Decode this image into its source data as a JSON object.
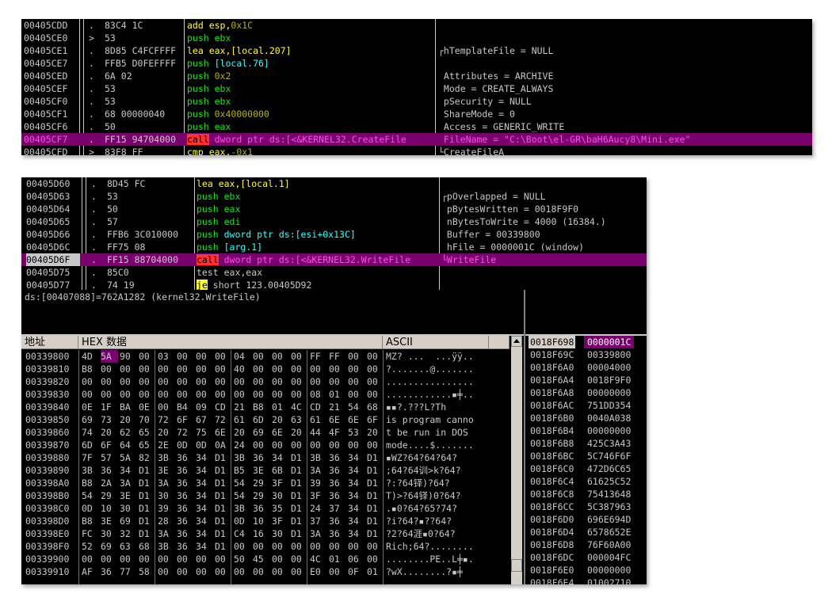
{
  "panel1": {
    "rows": [
      {
        "addr": "00405CDD",
        "mark": ".",
        "hex": "83C4 1C",
        "asm": [
          [
            "add esp,",
            "t-yel"
          ],
          [
            "0x1C",
            "t-olv"
          ]
        ],
        "comment": ""
      },
      {
        "addr": "00405CE0",
        "mark": ">",
        "hex": "53",
        "asm": [
          [
            "push ebx",
            "t-grn"
          ]
        ],
        "comment": ""
      },
      {
        "addr": "00405CE1",
        "mark": ".",
        "hex": "8D85 C4FCFFFF",
        "asm": [
          [
            "lea eax,[local.207]",
            "t-yel"
          ]
        ],
        "comment": "┌hTemplateFile = NULL"
      },
      {
        "addr": "00405CE7",
        "mark": ".",
        "hex": "FFB5 D0FEFFFF",
        "asm": [
          [
            "push ",
            "t-grn"
          ],
          [
            "[local.76]",
            "t-cyn"
          ]
        ],
        "comment": ""
      },
      {
        "addr": "00405CED",
        "mark": ".",
        "hex": "6A 02",
        "asm": [
          [
            "push ",
            "t-grn"
          ],
          [
            "0x2",
            "t-olv"
          ]
        ],
        "comment": " Attributes = ARCHIVE"
      },
      {
        "addr": "00405CEF",
        "mark": ".",
        "hex": "53",
        "asm": [
          [
            "push ebx",
            "t-grn"
          ]
        ],
        "comment": " Mode = CREATE_ALWAYS"
      },
      {
        "addr": "00405CF0",
        "mark": ".",
        "hex": "53",
        "asm": [
          [
            "push ebx",
            "t-grn"
          ]
        ],
        "comment": " pSecurity = NULL"
      },
      {
        "addr": "00405CF1",
        "mark": ".",
        "hex": "68 00000040",
        "asm": [
          [
            "push ",
            "t-grn"
          ],
          [
            "0x40000000",
            "t-olv"
          ]
        ],
        "comment": " ShareMode = 0"
      },
      {
        "addr": "00405CF6",
        "mark": ".",
        "hex": "50",
        "asm": [
          [
            "push eax",
            "t-grn"
          ]
        ],
        "comment": " Access = GENERIC_WRITE"
      },
      {
        "addr": "00405CF7",
        "mark": ".",
        "hex": "FF15 94704000",
        "asm": [
          [
            "call",
            "t-call"
          ],
          [
            " dword ptr ds:[<&KERNEL32.CreateFile",
            "t-mag"
          ]
        ],
        "comment": " FileName = \"C:\\Boot\\el-GR\\baH6Aucy8\\Mini.exe\""
      },
      {
        "addr": "00405CFD",
        "mark": ">",
        "hex": "83F8 FF",
        "asm": [
          [
            "cmp eax,",
            "t-yel"
          ],
          [
            "-0x1",
            "t-olv"
          ]
        ],
        "comment": "└CreateFileA"
      }
    ]
  },
  "panel2": {
    "rows": [
      {
        "addr": "00405D60",
        "mark": ".",
        "hex": "8D45 FC",
        "asm": [
          [
            "lea eax,[local.1]",
            "t-yel"
          ]
        ],
        "comment": ""
      },
      {
        "addr": "00405D63",
        "mark": ".",
        "hex": "53",
        "asm": [
          [
            "push ebx",
            "t-grn"
          ]
        ],
        "comment": "┌pOverlapped = NULL"
      },
      {
        "addr": "00405D64",
        "mark": ".",
        "hex": "50",
        "asm": [
          [
            "push eax",
            "t-grn"
          ]
        ],
        "comment": " pBytesWritten = 0018F9F0"
      },
      {
        "addr": "00405D65",
        "mark": ".",
        "hex": "57",
        "asm": [
          [
            "push edi",
            "t-grn"
          ]
        ],
        "comment": " nBytesToWrite = 4000 (16384.)"
      },
      {
        "addr": "00405D66",
        "mark": ".",
        "hex": "FFB6 3C010000",
        "asm": [
          [
            "push ",
            "t-grn"
          ],
          [
            "dword ptr ds:[esi+0x13C]",
            "t-cyn"
          ]
        ],
        "comment": " Buffer = 00339800"
      },
      {
        "addr": "00405D6C",
        "mark": ".",
        "hex": "FF75 08",
        "asm": [
          [
            "push ",
            "t-grn"
          ],
          [
            "[arg.1]",
            "t-cyn"
          ]
        ],
        "comment": " hFile = 0000001C (window)"
      },
      {
        "addr": "00405D6F",
        "mark": ".",
        "hex": "FF15 88704000",
        "asm": [
          [
            "call",
            "t-call"
          ],
          [
            " dword ptr ds:[<&KERNEL32.WriteFile",
            "t-mag"
          ]
        ],
        "comment": "└WriteFile"
      },
      {
        "addr": "00405D75",
        "mark": ".",
        "hex": "85C0",
        "asm": [
          [
            "test eax,eax",
            "t-wht"
          ]
        ],
        "comment": ""
      },
      {
        "addr": "00405D77",
        "mark": ".",
        "hex": "74 19",
        "asm": [
          [
            "je",
            "t-je"
          ],
          [
            " short 123.00405D92",
            "t-wht"
          ]
        ],
        "comment": ""
      }
    ]
  },
  "info_line": "ds:[00407088]=762A1282 (kernel32.WriteFile)",
  "dump": {
    "header_addr": "地址",
    "header_hex": "HEX 数据",
    "header_ascii": "ASCII",
    "rows": [
      {
        "addr": "00339800",
        "bytes": [
          "4D",
          "5A",
          "90",
          "00",
          "03",
          "00",
          "00",
          "00",
          "04",
          "00",
          "00",
          "00",
          "FF",
          "FF",
          "00",
          "00"
        ],
        "ascii": "MZ? ...  ...ÿÿ.."
      },
      {
        "addr": "00339810",
        "bytes": [
          "B8",
          "00",
          "00",
          "00",
          "00",
          "00",
          "00",
          "00",
          "40",
          "00",
          "00",
          "00",
          "00",
          "00",
          "00",
          "00"
        ],
        "ascii": "?.......@......."
      },
      {
        "addr": "00339820",
        "bytes": [
          "00",
          "00",
          "00",
          "00",
          "00",
          "00",
          "00",
          "00",
          "00",
          "00",
          "00",
          "00",
          "00",
          "00",
          "00",
          "00"
        ],
        "ascii": "................"
      },
      {
        "addr": "00339830",
        "bytes": [
          "00",
          "00",
          "00",
          "00",
          "00",
          "00",
          "00",
          "00",
          "00",
          "00",
          "00",
          "00",
          "08",
          "01",
          "00",
          "00"
        ],
        "ascii": "............▪╪.."
      },
      {
        "addr": "00339840",
        "bytes": [
          "0E",
          "1F",
          "BA",
          "0E",
          "00",
          "B4",
          "09",
          "CD",
          "21",
          "B8",
          "01",
          "4C",
          "CD",
          "21",
          "54",
          "68"
        ],
        "ascii": "▪▪?.???L?Th"
      },
      {
        "addr": "00339850",
        "bytes": [
          "69",
          "73",
          "20",
          "70",
          "72",
          "6F",
          "67",
          "72",
          "61",
          "6D",
          "20",
          "63",
          "61",
          "6E",
          "6E",
          "6F"
        ],
        "ascii": "is program canno"
      },
      {
        "addr": "00339860",
        "bytes": [
          "74",
          "20",
          "62",
          "65",
          "20",
          "72",
          "75",
          "6E",
          "20",
          "69",
          "6E",
          "20",
          "44",
          "4F",
          "53",
          "20"
        ],
        "ascii": "t be run in DOS "
      },
      {
        "addr": "00339870",
        "bytes": [
          "6D",
          "6F",
          "64",
          "65",
          "2E",
          "0D",
          "0D",
          "0A",
          "24",
          "00",
          "00",
          "00",
          "00",
          "00",
          "00",
          "00"
        ],
        "ascii": "mode....$......."
      },
      {
        "addr": "00339880",
        "bytes": [
          "7F",
          "57",
          "5A",
          "82",
          "3B",
          "36",
          "34",
          "D1",
          "3B",
          "36",
          "34",
          "D1",
          "3B",
          "36",
          "34",
          "D1"
        ],
        "ascii": "▪WZ?64?64?64?"
      },
      {
        "addr": "00339890",
        "bytes": [
          "3B",
          "36",
          "34",
          "D1",
          "3E",
          "36",
          "34",
          "D1",
          "B5",
          "3E",
          "6B",
          "D1",
          "3A",
          "36",
          "34",
          "D1"
        ],
        "ascii": ";64?64训>k?64?"
      },
      {
        "addr": "003398A0",
        "bytes": [
          "B8",
          "2A",
          "3A",
          "D1",
          "3A",
          "36",
          "34",
          "D1",
          "54",
          "29",
          "3F",
          "D1",
          "39",
          "36",
          "34",
          "D1"
        ],
        "ascii": "?:?64铎)?64?"
      },
      {
        "addr": "003398B0",
        "bytes": [
          "54",
          "29",
          "3E",
          "D1",
          "30",
          "36",
          "34",
          "D1",
          "54",
          "29",
          "30",
          "D1",
          "3F",
          "36",
          "34",
          "D1"
        ],
        "ascii": "T)>?64铎)0?64?"
      },
      {
        "addr": "003398C0",
        "bytes": [
          "0D",
          "10",
          "30",
          "D1",
          "39",
          "36",
          "34",
          "D1",
          "3B",
          "36",
          "35",
          "D1",
          "24",
          "37",
          "34",
          "D1"
        ],
        "ascii": ".▪0?64?65?74?"
      },
      {
        "addr": "003398D0",
        "bytes": [
          "B8",
          "3E",
          "69",
          "D1",
          "28",
          "36",
          "34",
          "D1",
          "0D",
          "10",
          "3F",
          "D1",
          "37",
          "36",
          "34",
          "D1"
        ],
        "ascii": "?i?64?▪??64?"
      },
      {
        "addr": "003398E0",
        "bytes": [
          "FC",
          "30",
          "32",
          "D1",
          "3A",
          "36",
          "34",
          "D1",
          "C4",
          "16",
          "30",
          "D1",
          "3A",
          "36",
          "34",
          "D1"
        ],
        "ascii": "?2?64涯▪0?64?"
      },
      {
        "addr": "003398F0",
        "bytes": [
          "52",
          "69",
          "63",
          "68",
          "3B",
          "36",
          "34",
          "D1",
          "00",
          "00",
          "00",
          "00",
          "00",
          "00",
          "00",
          "00"
        ],
        "ascii": "Rich;64?........"
      },
      {
        "addr": "00339900",
        "bytes": [
          "00",
          "00",
          "00",
          "00",
          "00",
          "00",
          "00",
          "00",
          "50",
          "45",
          "00",
          "00",
          "4C",
          "01",
          "06",
          "00"
        ],
        "ascii": "........PE..L╪▪."
      },
      {
        "addr": "00339910",
        "bytes": [
          "AF",
          "36",
          "77",
          "58",
          "00",
          "00",
          "00",
          "00",
          "00",
          "00",
          "00",
          "00",
          "E0",
          "00",
          "0F",
          "01"
        ],
        "ascii": "?wX........?▪╪"
      }
    ]
  },
  "stack": {
    "rows": [
      {
        "addr": "0018F698",
        "val": "0000001C"
      },
      {
        "addr": "0018F69C",
        "val": "00339800"
      },
      {
        "addr": "0018F6A0",
        "val": "00004000"
      },
      {
        "addr": "0018F6A4",
        "val": "0018F9F0"
      },
      {
        "addr": "0018F6A8",
        "val": "00000000"
      },
      {
        "addr": "0018F6AC",
        "val": "751DD354"
      },
      {
        "addr": "0018F6B0",
        "val": "0040A038"
      },
      {
        "addr": "0018F6B4",
        "val": "00000000"
      },
      {
        "addr": "0018F6B8",
        "val": "425C3A43"
      },
      {
        "addr": "0018F6BC",
        "val": "5C746F6F"
      },
      {
        "addr": "0018F6C0",
        "val": "472D6C65"
      },
      {
        "addr": "0018F6C4",
        "val": "61625C52"
      },
      {
        "addr": "0018F6C8",
        "val": "75413648"
      },
      {
        "addr": "0018F6CC",
        "val": "5C387963"
      },
      {
        "addr": "0018F6D0",
        "val": "696E694D"
      },
      {
        "addr": "0018F6D4",
        "val": "6578652E"
      },
      {
        "addr": "0018F6D8",
        "val": "76F60A00"
      },
      {
        "addr": "0018F6DC",
        "val": "000004FC"
      },
      {
        "addr": "0018F6E0",
        "val": "00000000"
      },
      {
        "addr": "0018F6E4",
        "val": "01002710"
      }
    ]
  }
}
